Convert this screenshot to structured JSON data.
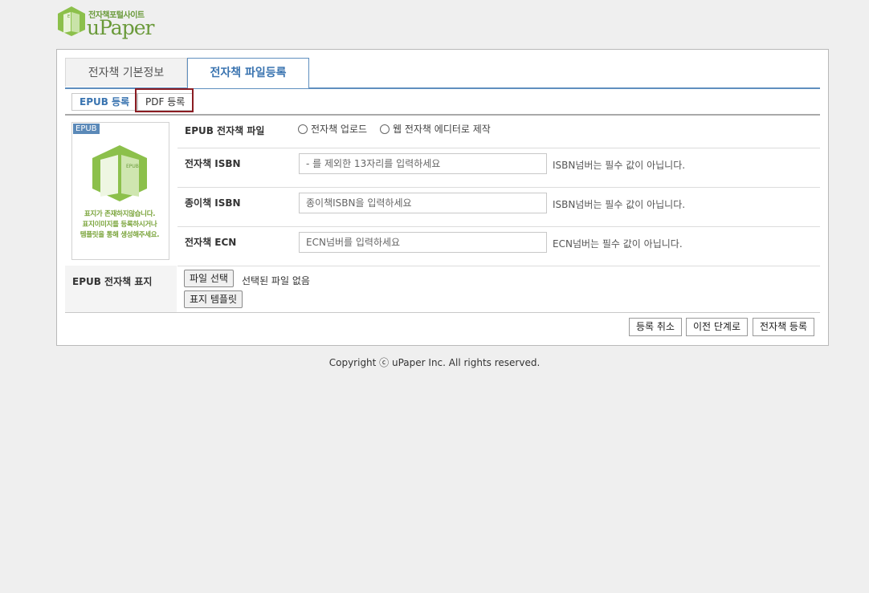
{
  "logo": {
    "subtitle": "전자책포털사이트",
    "brand": "uPaper"
  },
  "tabs": [
    {
      "label": "전자책 기본정보"
    },
    {
      "label": "전자책 파일등록"
    }
  ],
  "subtabs": [
    {
      "label": "EPUB 등록"
    },
    {
      "label": "PDF 등록"
    }
  ],
  "cover_preview": {
    "badge": "EPUB",
    "message_lines": [
      "표지가 존재하지않습니다.",
      "표지이미지를 등록하시거나",
      "템플릿을 통해 생성해주세요."
    ]
  },
  "form": {
    "file_row": {
      "label": "EPUB 전자책 파일",
      "options": [
        "전자책 업로드",
        "웹 전자책 에디터로 제작"
      ]
    },
    "isbn_row": {
      "label": "전자책 ISBN",
      "placeholder": "- 를 제외한 13자리를 입력하세요",
      "hint": "ISBN넘버는 필수 값이 아닙니다."
    },
    "paper_isbn_row": {
      "label": "종이책 ISBN",
      "placeholder": "종이책ISBN을 입력하세요",
      "hint": "ISBN넘버는 필수 값이 아닙니다."
    },
    "ecn_row": {
      "label": "전자책 ECN",
      "placeholder": "ECN넘버를 입력하세요",
      "hint": "ECN넘버는 필수 값이 아닙니다."
    },
    "cover_row": {
      "label": "EPUB 전자책 표지",
      "file_button": "파일 선택",
      "file_status": "선택된 파일 없음",
      "template_button": "표지 템플릿"
    }
  },
  "actions": {
    "cancel": "등록 취소",
    "previous": "이전 단계로",
    "submit": "전자책 등록"
  },
  "footer": {
    "copyright": "Copyright ⓒ uPaper Inc. All rights reserved."
  },
  "colors": {
    "brand_green": "#6a9a3a",
    "accent_blue": "#3a74b0",
    "highlight_red": "#8b1c22"
  }
}
